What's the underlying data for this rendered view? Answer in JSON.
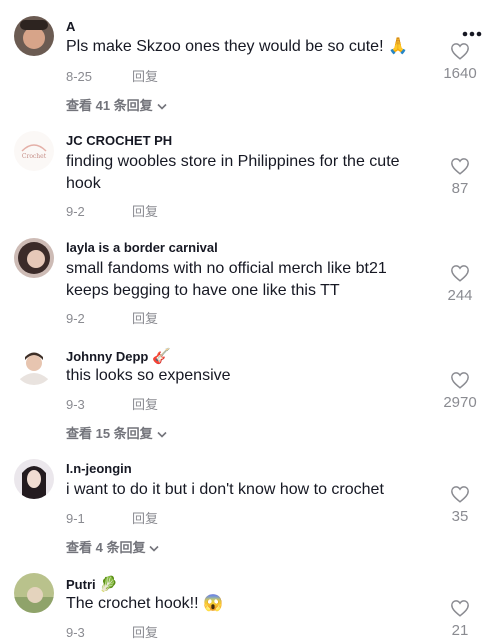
{
  "comments": [
    {
      "username": "A",
      "text": "Pls make Skzoo ones they would be so cute! 🙏",
      "date": "8-25",
      "reply_label": "回复",
      "likes": "1640",
      "view_replies": "查看 41 条回复",
      "avatar_colors": [
        "#7a6a60",
        "#d9a58a"
      ]
    },
    {
      "username": "JC CROCHET PH",
      "text": "finding woobles store in Philippines for the cute hook",
      "date": "9-2",
      "reply_label": "回复",
      "likes": "87",
      "avatar_colors": [
        "#f7f3f0",
        "#e0a8a0"
      ]
    },
    {
      "username": "layla is a border carnival",
      "text": "small fandoms with no official merch like bt21 keeps begging to have one like this TT",
      "date": "9-2",
      "reply_label": "回复",
      "likes": "244",
      "avatar_colors": [
        "#c9b6b0",
        "#3a2a28"
      ]
    },
    {
      "username": "Johnny Depp",
      "username_emoji": "🎸",
      "text": "this looks so expensive",
      "date": "9-3",
      "reply_label": "回复",
      "likes": "2970",
      "view_replies": "查看 15 条回复",
      "avatar_colors": [
        "#ffffff",
        "#4a3a30"
      ]
    },
    {
      "username": "I.n-jeongin",
      "text": "i want to do it but i don't know how to crochet",
      "date": "9-1",
      "reply_label": "回复",
      "likes": "35",
      "view_replies": "查看 4 条回复",
      "avatar_colors": [
        "#e8e4ea",
        "#2a2226"
      ]
    },
    {
      "username": "Putri",
      "username_emoji": "🥬",
      "text": "The crochet hook!! 😱",
      "date": "9-3",
      "reply_label": "回复",
      "likes": "21",
      "avatar_colors": [
        "#b7c08a",
        "#d6c7a8"
      ]
    }
  ],
  "icons": {
    "more": "more-options-icon",
    "like": "heart-outline-icon",
    "expand": "chevron-down-icon"
  }
}
